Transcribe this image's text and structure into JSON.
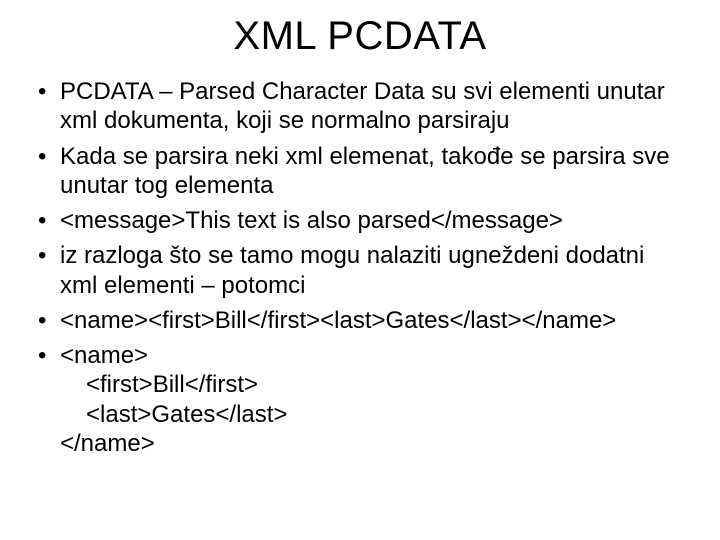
{
  "title": "XML PCDATA",
  "bullets": [
    "PCDATA – Parsed Character Data su svi elementi unutar xml dokumenta, koji se normalno parsiraju",
    "Kada se parsira neki xml elemenat, takođe se parsira sve unutar tog elementa",
    "<message>This text is also parsed</message>",
    "iz razloga što se tamo mogu nalaziti ugneždeni dodatni xml elementi – potomci",
    "<name><first>Bill</first><last>Gates</last></name>"
  ],
  "last_bullet": {
    "l1": "<name>",
    "l2": "<first>Bill</first>",
    "l3": "<last>Gates</last>",
    "l4": "</name>"
  }
}
